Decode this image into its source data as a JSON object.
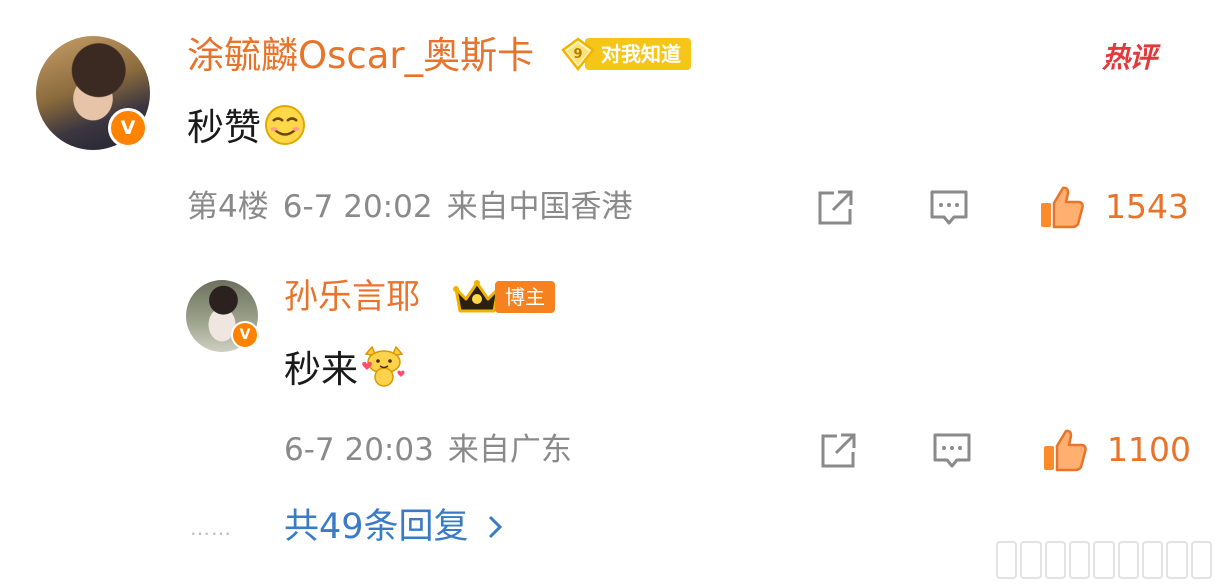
{
  "comment": {
    "author": "涂毓麟Oscar_奥斯卡",
    "level_number": "9",
    "level_label": "对我知道",
    "hot_label": "热评",
    "text": "秒赞",
    "emoji": "smiling-face-emoji",
    "floor": "第4楼",
    "time": "6-7 20:02",
    "location": "来自中国香港",
    "like_count": "1543"
  },
  "reply": {
    "author": "孙乐言耶",
    "badge_label": "博主",
    "text": "秒来",
    "emoji": "dancing-cat-emoji",
    "time": "6-7 20:03",
    "location": "来自广东",
    "like_count": "1100"
  },
  "replies_footer": {
    "dots": "……",
    "more_text": "共49条回复"
  },
  "colors": {
    "name": "#e8732a",
    "link": "#3a7bc8",
    "meta": "#8a8a8a",
    "verified": "#ff8200",
    "hot": "#e4393c"
  },
  "icons": [
    "share-icon",
    "comment-icon",
    "thumbs-up-icon",
    "chevron-right-icon",
    "crown-icon",
    "diamond-icon",
    "verified-icon"
  ]
}
